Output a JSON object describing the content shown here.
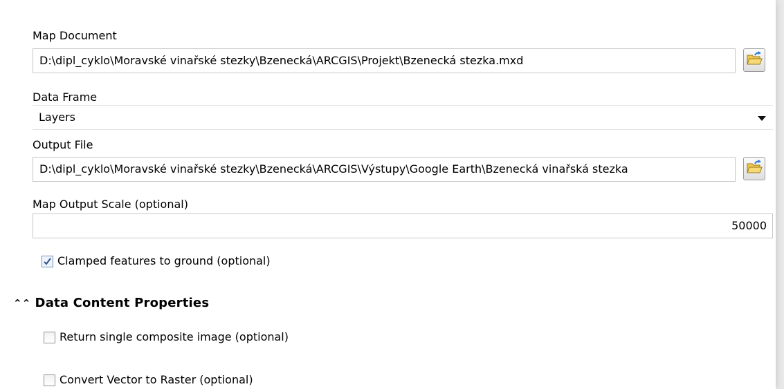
{
  "map_document": {
    "label": "Map Document",
    "value": "D:\\dipl_cyklo\\Moravské vinařské stezky\\Bzenecká\\ARCGIS\\Projekt\\Bzenecká stezka.mxd",
    "browse_icon": "open-folder-icon"
  },
  "data_frame": {
    "label": "Data Frame",
    "value": "Layers",
    "dropdown_icon": "chevron-down-icon"
  },
  "output_file": {
    "label": "Output File",
    "value": "D:\\dipl_cyklo\\Moravské vinařské stezky\\Bzenecká\\ARCGIS\\Výstupy\\Google Earth\\Bzenecká vinařská stezka",
    "browse_icon": "open-folder-icon"
  },
  "map_output_scale": {
    "label": "Map Output Scale (optional)",
    "value": "50000"
  },
  "clamped_features": {
    "label": "Clamped features to ground (optional)",
    "checked": true
  },
  "data_content_section": {
    "title": "Data Content Properties",
    "icon": "double-chevron-up-icon"
  },
  "return_single_composite": {
    "label": "Return single composite image (optional)",
    "checked": false
  },
  "convert_vector_to_raster": {
    "label": "Convert Vector to Raster (optional)",
    "checked": false
  },
  "colors": {
    "folder": "#f2c84b",
    "folder_outline": "#9a7a1c",
    "arrow": "#2f7bd6"
  }
}
